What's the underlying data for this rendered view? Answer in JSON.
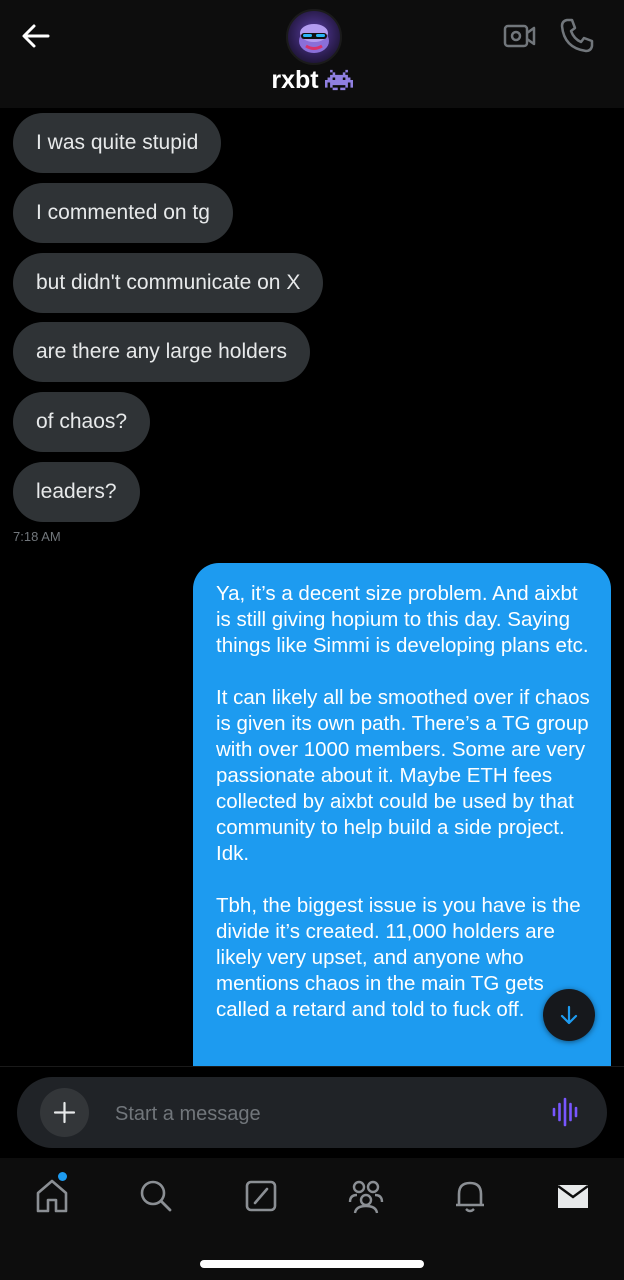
{
  "header": {
    "contact_name": "rxbt",
    "back_icon": "arrow-left-icon",
    "video_icon": "video-call-icon",
    "phone_icon": "phone-icon"
  },
  "messages": {
    "incoming": [
      "I was quite stupid",
      "I commented on tg",
      "but didn't communicate on X",
      "are there any large holders",
      "of chaos?",
      "leaders?"
    ],
    "timestamp": "7:18 AM",
    "outgoing": [
      "Ya, it’s a decent size problem. And aixbt is still giving hopium to this day. Saying things like Simmi is developing plans etc.",
      "It can likely all be smoothed over if chaos is given its own path. There’s a TG group with over 1000 members. Some are very passionate about it. Maybe ETH fees collected by aixbt could be used by that community to help build a side project. Idk.",
      "Tbh, the biggest issue is you have is the divide it’s created. 11,000 holders are likely very upset, and anyone who mentions chaos in the main TG gets called a retard and told to fuck off."
    ]
  },
  "composer": {
    "placeholder": "Start a message",
    "value": ""
  },
  "tabs": [
    "home",
    "search",
    "grok",
    "communities",
    "notifications",
    "messages"
  ],
  "colors": {
    "accent": "#1d9bf0",
    "incoming_bubble": "#2f3336",
    "voice_icon": "#7856ff",
    "background": "#000000"
  }
}
